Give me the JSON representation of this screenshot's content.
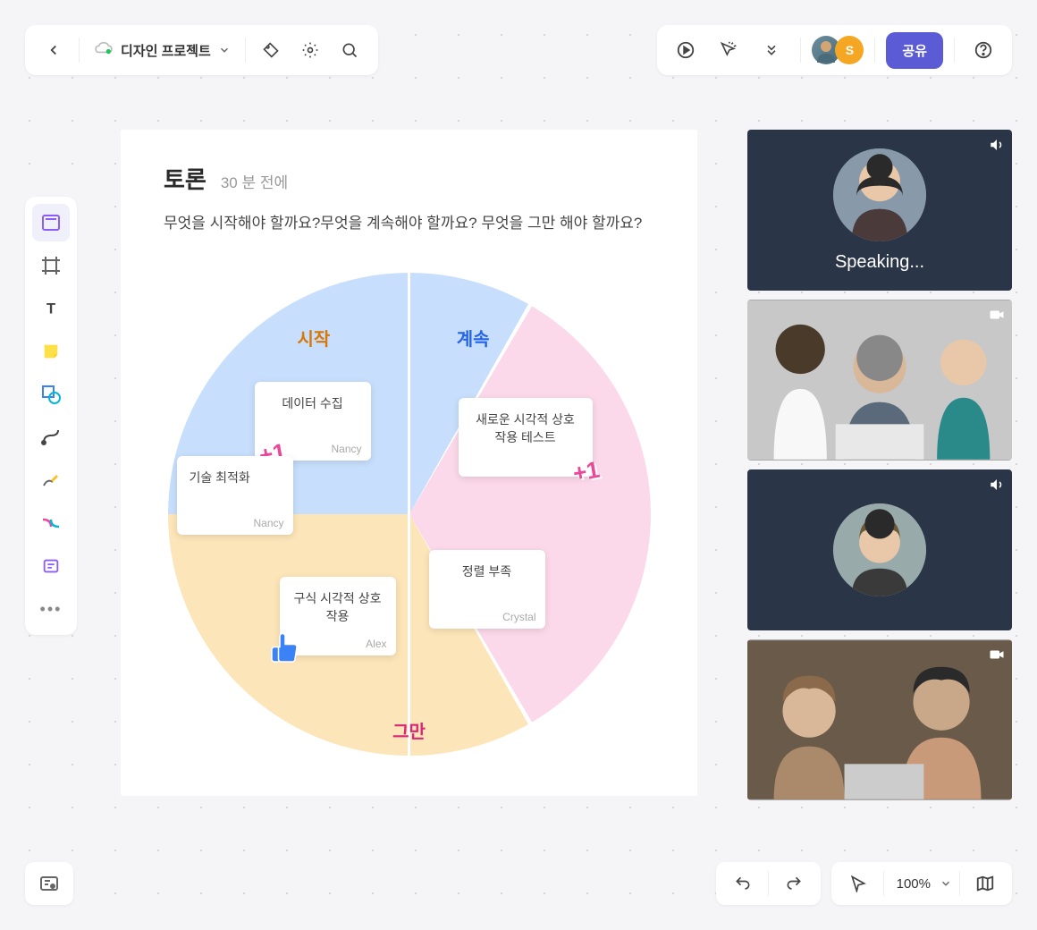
{
  "header": {
    "project_name": "디자인 프로젝트",
    "share_label": "공유",
    "user2_initial": "S"
  },
  "canvas": {
    "title": "토론",
    "time": "30 분 전에",
    "question": "무엇을 시작해야 할까요?무엇을 계속해야 할까요?  무엇을 그만 해야 할까요?"
  },
  "wheel": {
    "start_label": "시작",
    "continue_label": "계속",
    "stop_label": "그만"
  },
  "stickies": {
    "s1": {
      "text": "데이터 수집",
      "author": "Nancy",
      "plus1": "+1"
    },
    "s2": {
      "text": "기술 최적화",
      "author": "Nancy"
    },
    "s3": {
      "text": "새로운 시각적 상호 작용 테스트",
      "author": "",
      "plus1": "+1"
    },
    "s4": {
      "text": "구식 시각적 상호 작용",
      "author": "Alex"
    },
    "s5": {
      "text": "정렬 부족",
      "author": "Crystal"
    }
  },
  "video": {
    "speaking_label": "Speaking..."
  },
  "bottom": {
    "zoom": "100%"
  }
}
